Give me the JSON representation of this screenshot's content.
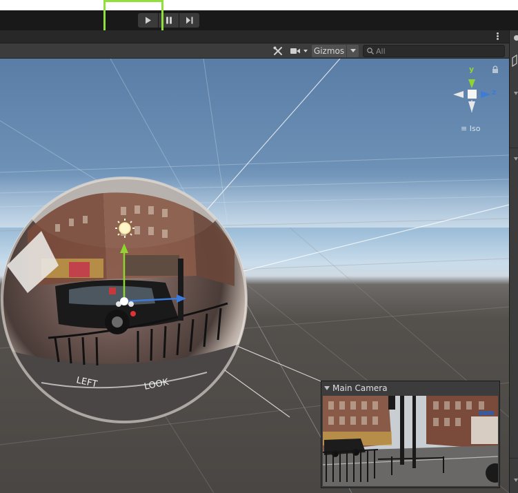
{
  "play_toolbar": {
    "buttons": [
      {
        "name": "play",
        "icon": "play-icon"
      },
      {
        "name": "pause",
        "icon": "pause-icon"
      },
      {
        "name": "step",
        "icon": "step-icon"
      }
    ],
    "highlight_color": "#8fe03a"
  },
  "scene_toolbar": {
    "tools_icon": "tools-icon",
    "camera_icon": "camera-icon",
    "gizmos_label": "Gizmos",
    "search_placeholder": "All"
  },
  "orientation_gizmo": {
    "y_label": "y",
    "z_label": "z",
    "projection_label": "Iso",
    "colors": {
      "y": "#8fd431",
      "z": "#3d7bd9"
    }
  },
  "camera_preview": {
    "title": "Main Camera"
  },
  "colors": {
    "editor_dark": "#191919",
    "panel": "#3c3c3c",
    "accent_highlight": "#8fe03a"
  }
}
